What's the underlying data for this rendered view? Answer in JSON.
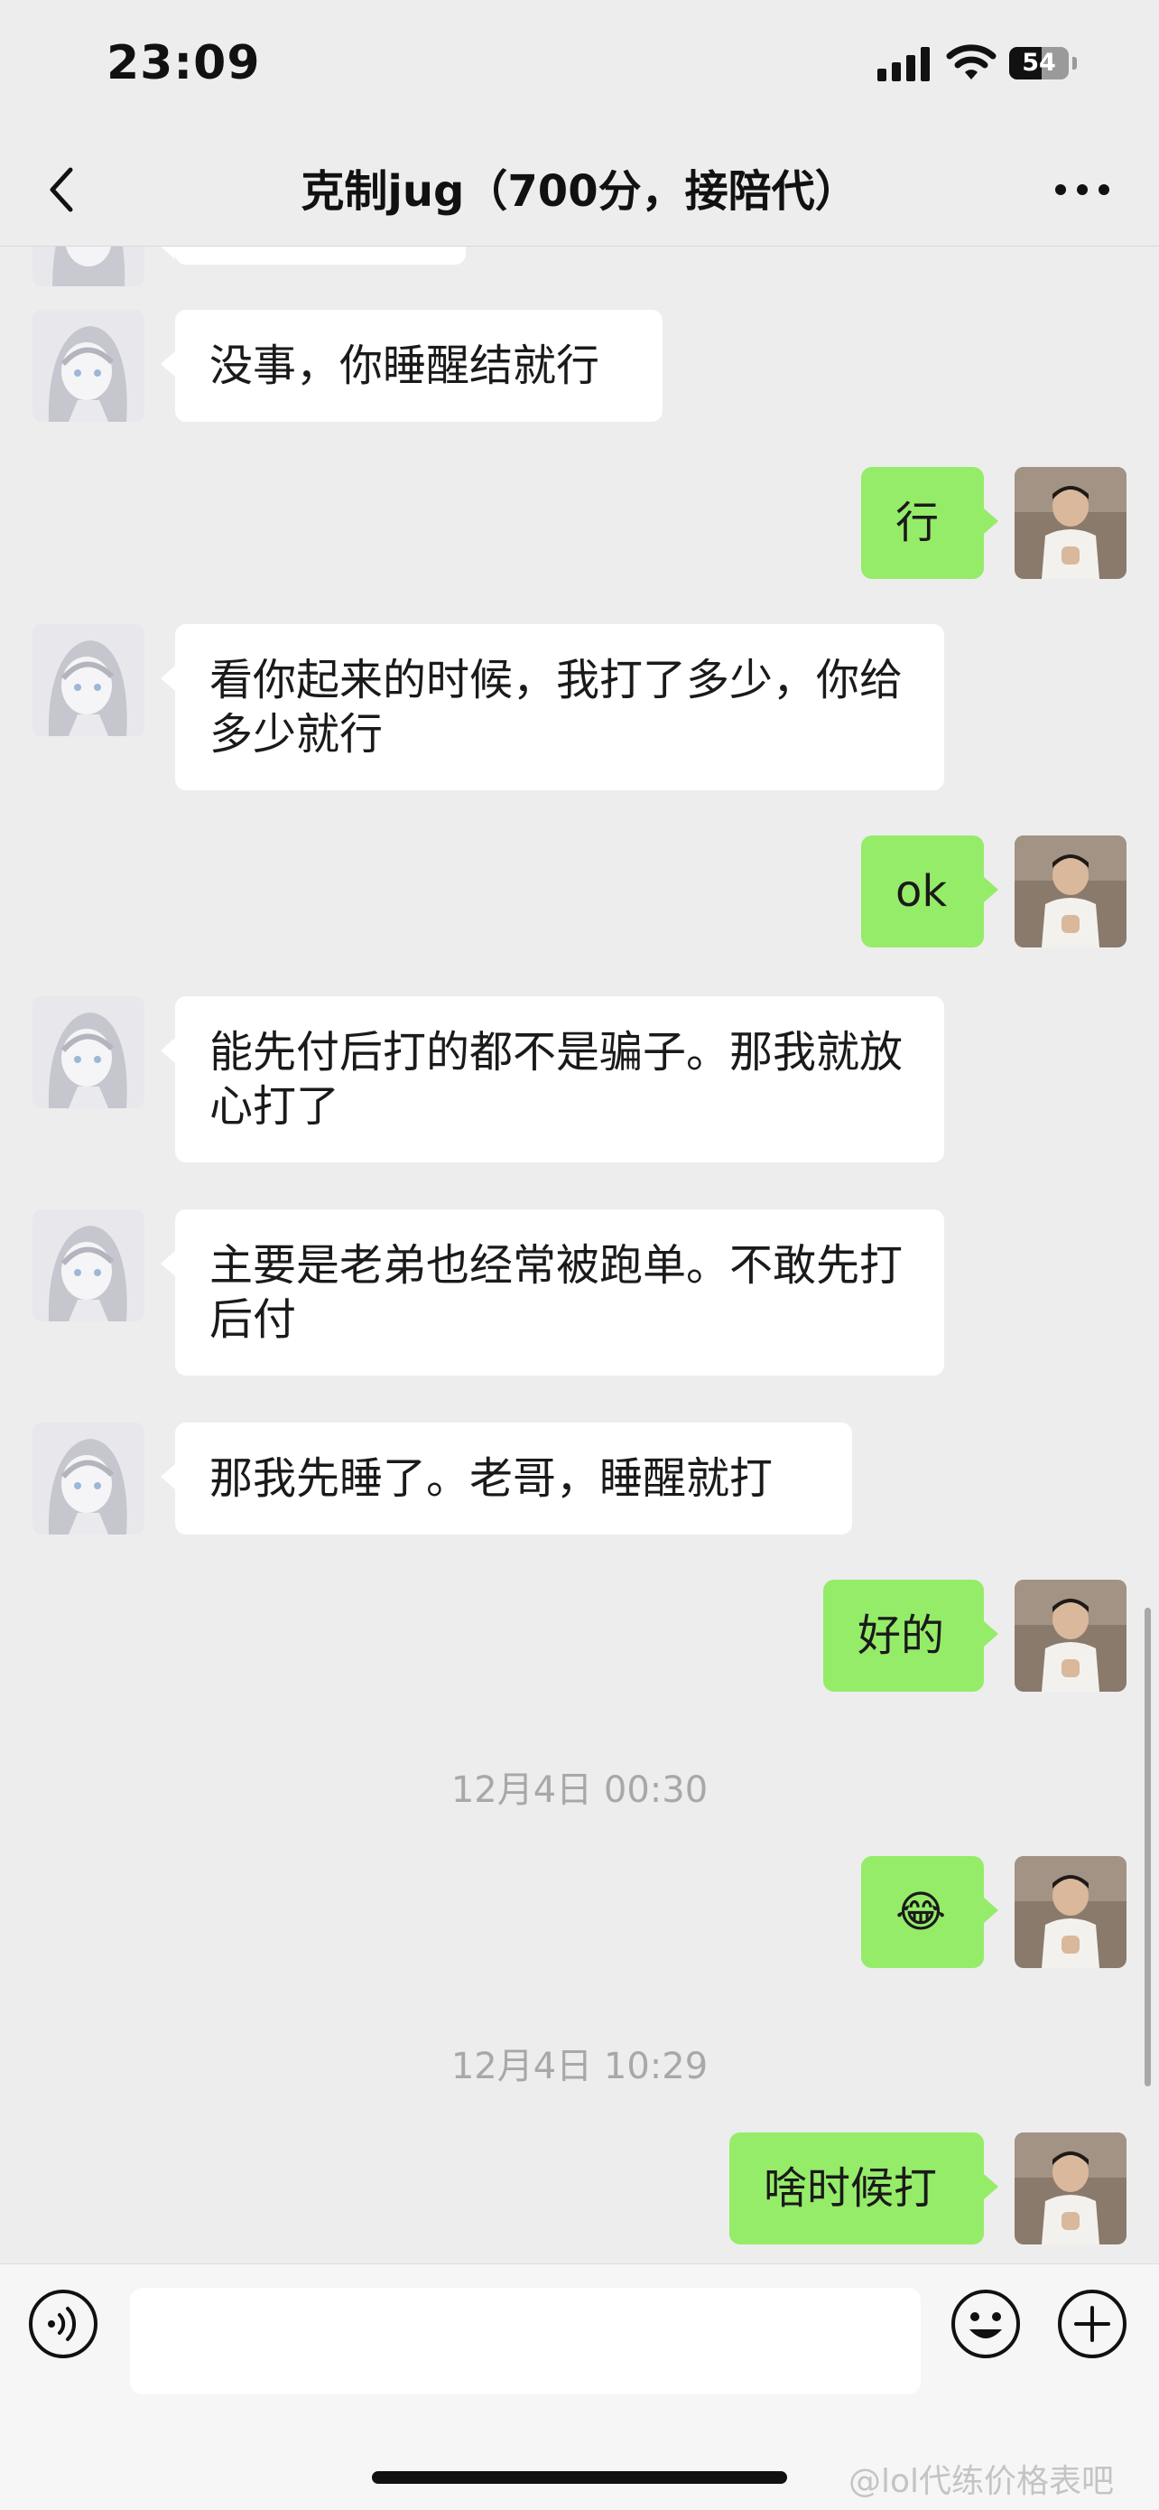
{
  "status_bar": {
    "time": "23:09",
    "battery": "54",
    "battery_level": 0.54
  },
  "header": {
    "title": "克制jug（700分，接陪代）"
  },
  "messages": [
    {
      "side": "in",
      "text": "没事，你睡醒结就行"
    },
    {
      "side": "out",
      "text": "行"
    },
    {
      "side": "in",
      "text": "看你起来的时候，我打了多少，你给多少就行"
    },
    {
      "side": "out",
      "text": "ok"
    },
    {
      "side": "in",
      "text": "能先付后打的都不是骗子。那我就放心打了"
    },
    {
      "side": "in",
      "text": "主要是老弟也经常被跑单。不敢先打后付"
    },
    {
      "side": "in",
      "text": "那我先睡了。老哥，睡醒就打"
    },
    {
      "side": "out",
      "text": "好的"
    },
    {
      "type": "time",
      "text": "12月4日 00:30"
    },
    {
      "side": "out",
      "text": "😂"
    },
    {
      "type": "time",
      "text": "12月4日 10:29"
    },
    {
      "side": "out",
      "text": "啥时候打"
    }
  ],
  "input": {
    "value": "",
    "placeholder": ""
  },
  "watermark": "@lol代练价格表吧",
  "colors": {
    "background": "#ededed",
    "outgoing_bubble": "#95ec69",
    "incoming_bubble": "#ffffff",
    "timestamp": "#a8a8a8"
  },
  "icons": [
    "back-icon",
    "more-icon",
    "voice-icon",
    "emoji-icon",
    "add-icon"
  ]
}
